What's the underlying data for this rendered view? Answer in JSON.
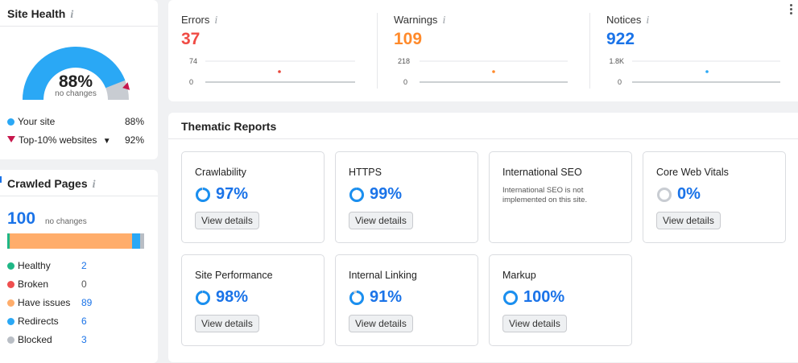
{
  "site_health": {
    "title": "Site Health",
    "info_icon": "i",
    "score": "88%",
    "change": "no changes",
    "score_fraction": 0.88,
    "top10_fraction": 0.92,
    "legend": [
      {
        "label": "Your site",
        "value": "88%",
        "color": "#2aa8f5"
      },
      {
        "label": "Top-10% websites",
        "value": "92%",
        "color": "#c7174c"
      }
    ]
  },
  "crawled_pages": {
    "title": "Crawled Pages",
    "info_icon": "i",
    "total": "100",
    "change": "no changes",
    "segments": [
      {
        "label": "Healthy",
        "value": "2",
        "color": "#1fb786"
      },
      {
        "label": "Broken",
        "value": "0",
        "color": "#ef4f4f"
      },
      {
        "label": "Have issues",
        "value": "89",
        "color": "#ffad6b"
      },
      {
        "label": "Redirects",
        "value": "6",
        "color": "#2aa8f5"
      },
      {
        "label": "Blocked",
        "value": "3",
        "color": "#b9bec5"
      }
    ]
  },
  "issues": [
    {
      "label": "Errors",
      "info_icon": "i",
      "value": "37",
      "color": "#f04b44",
      "max_tick": "74",
      "zero_tick": "0",
      "dot_color": "#e8463b"
    },
    {
      "label": "Warnings",
      "info_icon": "i",
      "value": "109",
      "color": "#ff8a2b",
      "max_tick": "218",
      "zero_tick": "0",
      "dot_color": "#ff8a2b"
    },
    {
      "label": "Notices",
      "info_icon": "i",
      "value": "922",
      "color": "#1a73e8",
      "max_tick": "1.8K",
      "zero_tick": "0",
      "dot_color": "#2aa8f5"
    }
  ],
  "thematic": {
    "title": "Thematic Reports",
    "reports": [
      {
        "title": "Crawlability",
        "value": "97%",
        "fraction": 0.97,
        "button": "View details"
      },
      {
        "title": "HTTPS",
        "value": "99%",
        "fraction": 0.99,
        "button": "View details"
      },
      {
        "title": "International SEO",
        "note": "International SEO is not implemented on this site."
      },
      {
        "title": "Core Web Vitals",
        "value": "0%",
        "fraction": 0,
        "button": "View details"
      },
      {
        "title": "Site Performance",
        "value": "98%",
        "fraction": 0.98,
        "button": "View details"
      },
      {
        "title": "Internal Linking",
        "value": "91%",
        "fraction": 0.91,
        "button": "View details"
      },
      {
        "title": "Markup",
        "value": "100%",
        "fraction": 1,
        "button": "View details"
      }
    ]
  }
}
